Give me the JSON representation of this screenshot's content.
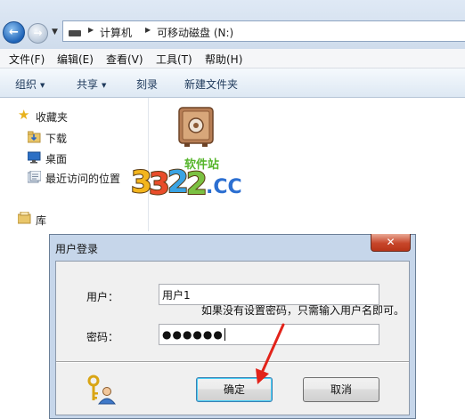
{
  "address_bar": {
    "path": [
      "计算机",
      "可移动磁盘 (N:)"
    ]
  },
  "menubar": {
    "items": [
      "文件(F)",
      "编辑(E)",
      "查看(V)",
      "工具(T)",
      "帮助(H)"
    ]
  },
  "toolbar": {
    "organize": "组织",
    "share": "共享",
    "burn": "刻录",
    "new_folder": "新建文件夹"
  },
  "nav_pane": {
    "favorites": "收藏夹",
    "downloads": "下载",
    "desktop": "桌面",
    "recent": "最近访问的位置",
    "libraries": "库"
  },
  "watermark": {
    "brand": "3322.cc",
    "tagline": "软件站"
  },
  "dialog": {
    "title": "用户登录",
    "user_label": "用户：",
    "user_value": "用户1",
    "password_label": "密码：",
    "password_value": "●●●●●●",
    "ok_label": "确定",
    "cancel_label": "取消"
  },
  "annotation": "如果没有设置密码，只需输入用户名即可。",
  "colors": {
    "annotation_arrow": "#e2231a",
    "explorer_text": "#1e395b"
  },
  "icons": [
    "back-arrow-icon",
    "forward-arrow-icon",
    "drive-icon",
    "star-icon",
    "downloads-folder-icon",
    "desktop-icon",
    "recent-places-icon",
    "library-icon",
    "safe-icon",
    "keys-user-icon",
    "close-icon"
  ]
}
